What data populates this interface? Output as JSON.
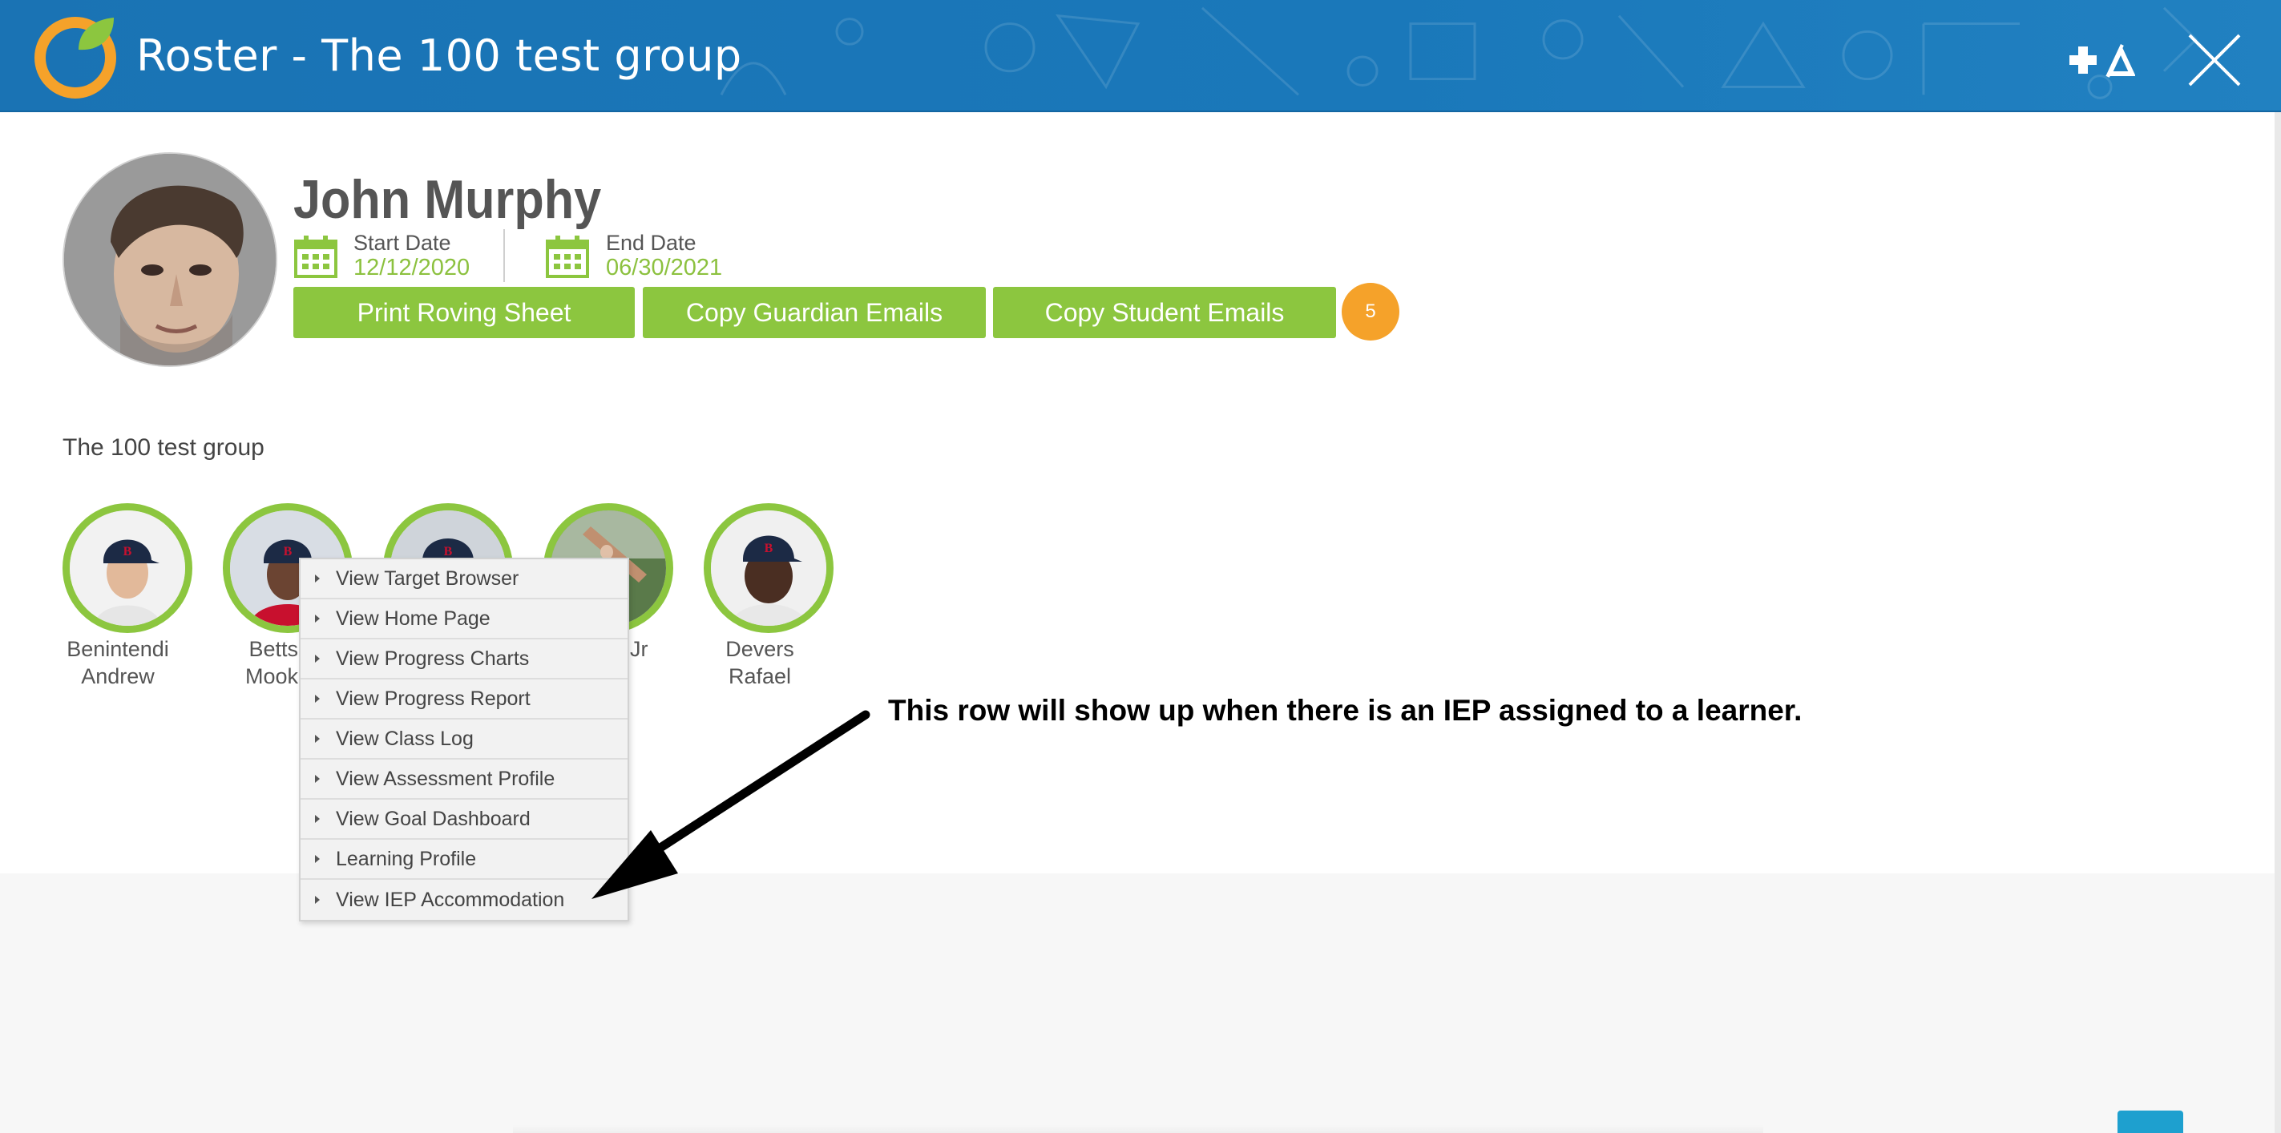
{
  "header": {
    "title": "Roster - The 100 test group",
    "logo_icon": "orange-ring-leaf-logo",
    "add_icon": "plus-triangle-icon",
    "close_icon": "close-x-icon"
  },
  "profile": {
    "name": "John Murphy",
    "start_date_label": "Start Date",
    "start_date_value": "12/12/2020",
    "end_date_label": "End Date",
    "end_date_value": "06/30/2021"
  },
  "actions": {
    "print_roving_sheet": "Print Roving Sheet",
    "copy_guardian_emails": "Copy Guardian Emails",
    "copy_student_emails": "Copy Student Emails",
    "count_badge": "5"
  },
  "group": {
    "label": "The 100 test group",
    "students": [
      {
        "line1": "Benintendi",
        "line2": "Andrew"
      },
      {
        "line1": "Betts",
        "line2": "Mook"
      },
      {
        "line1": "",
        "line2": ""
      },
      {
        "line1": "Jr",
        "line2": ""
      },
      {
        "line1": "Devers",
        "line2": "Rafael"
      }
    ]
  },
  "context_menu": {
    "items": [
      "View Target Browser",
      "View Home Page",
      "View Progress Charts",
      "View Progress Report",
      "View Class Log",
      "View Assessment Profile",
      "View Goal Dashboard",
      "Learning Profile",
      "View IEP Accommodation"
    ]
  },
  "annotation": {
    "text": "This row will show up when there is an IEP assigned to a learner."
  },
  "colors": {
    "header_blue": "#1a78ba",
    "accent_green": "#8cc63f",
    "badge_orange": "#f5a22a",
    "date_green": "#8cc13f"
  }
}
